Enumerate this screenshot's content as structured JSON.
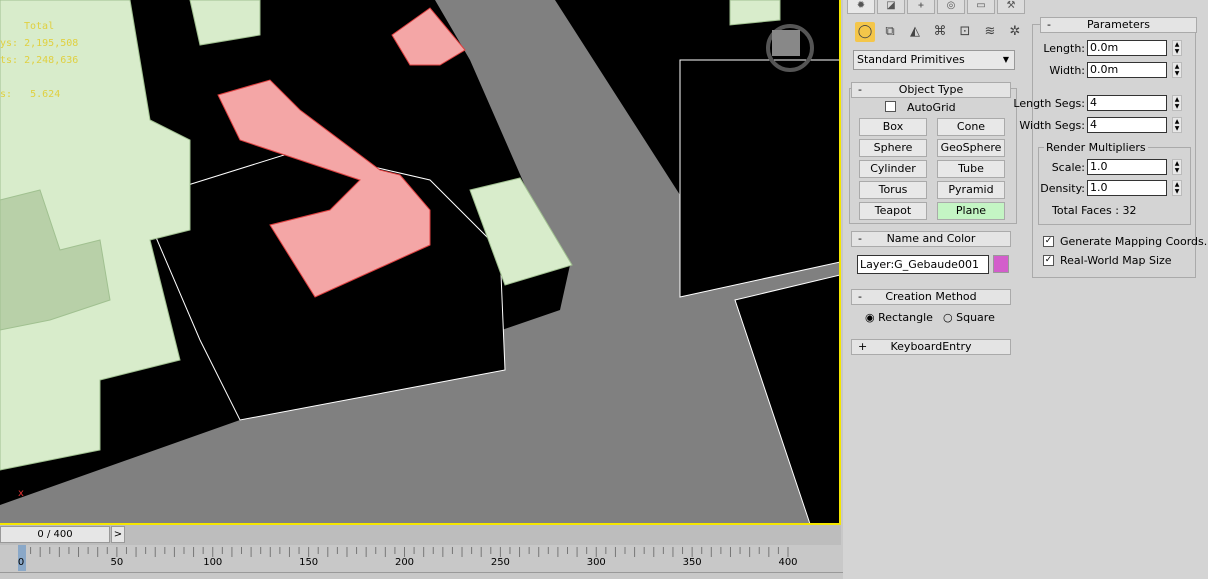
{
  "viewport": {
    "stats": {
      "header": "Total",
      "polys_label": "ys:",
      "polys": "2,195,508",
      "verts_label": "ts:",
      "verts": "2,248,636",
      "fps_label": "s:",
      "fps": "5.624"
    },
    "axis_label": "x"
  },
  "timeslider": {
    "frame": "0 / 400",
    "next": ">"
  },
  "ruler": {
    "labels": [
      "0",
      "50",
      "100",
      "150",
      "200",
      "250",
      "300",
      "350",
      "400"
    ]
  },
  "panel": {
    "tabs": [
      "create-icon",
      "modify-icon",
      "hierarchy-icon",
      "motion-icon",
      "display-icon",
      "utilities-icon"
    ],
    "category_icons": [
      "geometry-icon",
      "shapes-icon",
      "lights-icon",
      "cameras-icon",
      "helpers-icon",
      "spacewarps-icon",
      "systems-icon"
    ],
    "dropdown": "Standard Primitives",
    "object_type": {
      "title": "Object Type",
      "autogrid": "AutoGrid",
      "buttons": [
        "Box",
        "Cone",
        "Sphere",
        "GeoSphere",
        "Cylinder",
        "Tube",
        "Torus",
        "Pyramid",
        "Teapot",
        "Plane"
      ],
      "active": "Plane"
    },
    "name_color": {
      "title": "Name and Color",
      "name": "Layer:G_Gebaude001",
      "color": "#d35ecb"
    },
    "creation_method": {
      "title": "Creation Method",
      "options": [
        "Rectangle",
        "Square"
      ],
      "selected": "Rectangle"
    },
    "keyboard_entry": {
      "title": "KeyboardEntry"
    },
    "parameters": {
      "title": "Parameters",
      "length_label": "Length:",
      "length": "0.0m",
      "width_label": "Width:",
      "width": "0.0m",
      "length_segs_label": "Length Segs:",
      "length_segs": "4",
      "width_segs_label": "Width Segs:",
      "width_segs": "4",
      "render_multipliers": "Render Multipliers",
      "scale_label": "Scale:",
      "scale": "1.0",
      "density_label": "Density:",
      "density": "1.0",
      "total_faces": "Total Faces : 32",
      "gen_mapping": "Generate Mapping Coords.",
      "real_world": "Real-World Map Size"
    }
  },
  "colors": {
    "accent": "#f5e600",
    "active_button": "#c4f5c4",
    "building": "#d8eccb",
    "roof": "#f4a6a6",
    "road": "#808080"
  }
}
